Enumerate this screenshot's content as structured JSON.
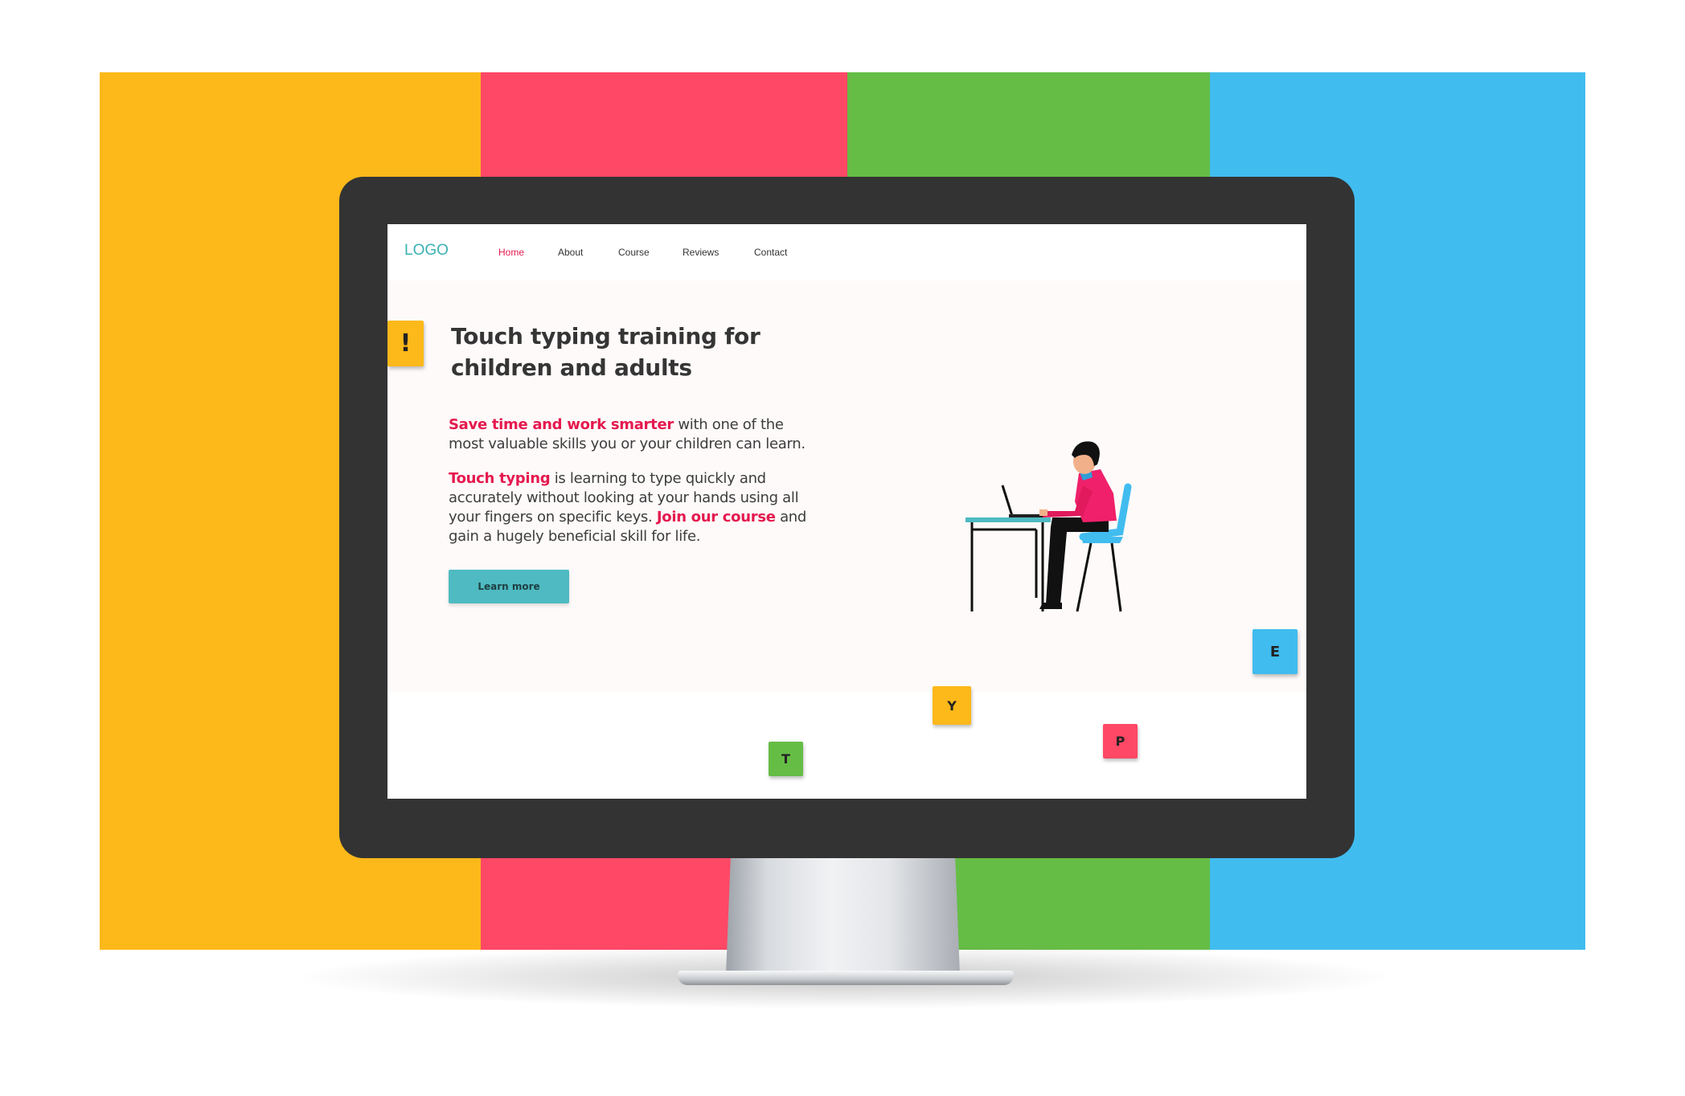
{
  "colors": {
    "stripe_yellow": "#fdb81a",
    "stripe_red": "#fe4866",
    "stripe_green": "#65bd45",
    "stripe_blue": "#41bcef",
    "accent_red": "#e5194f",
    "teal": "#4fbac1"
  },
  "nav": {
    "logo": "LOGO",
    "items": [
      {
        "label": "Home",
        "active": true
      },
      {
        "label": "About"
      },
      {
        "label": "Course"
      },
      {
        "label": "Reviews"
      },
      {
        "label": "Contact"
      }
    ]
  },
  "hero": {
    "title": "Touch typing training for children and adults",
    "para1": {
      "highlight": "Save time and work smarter",
      "text": " with one of the most valuable skills you or your children can learn."
    },
    "para2": {
      "highlight1": "Touch typing",
      "text1": " is learning to type quickly and accurately without looking at your hands using all your fingers on specific keys. ",
      "highlight2": "Join our course",
      "text2": " and gain a hugely beneficial skill for life."
    },
    "button": "Learn more"
  },
  "tiles": {
    "exclaim": "!",
    "e": "E",
    "y": "Y",
    "t": "T",
    "p": "P"
  },
  "icons": {
    "illustration": "person-typing-at-desk-illustration"
  }
}
